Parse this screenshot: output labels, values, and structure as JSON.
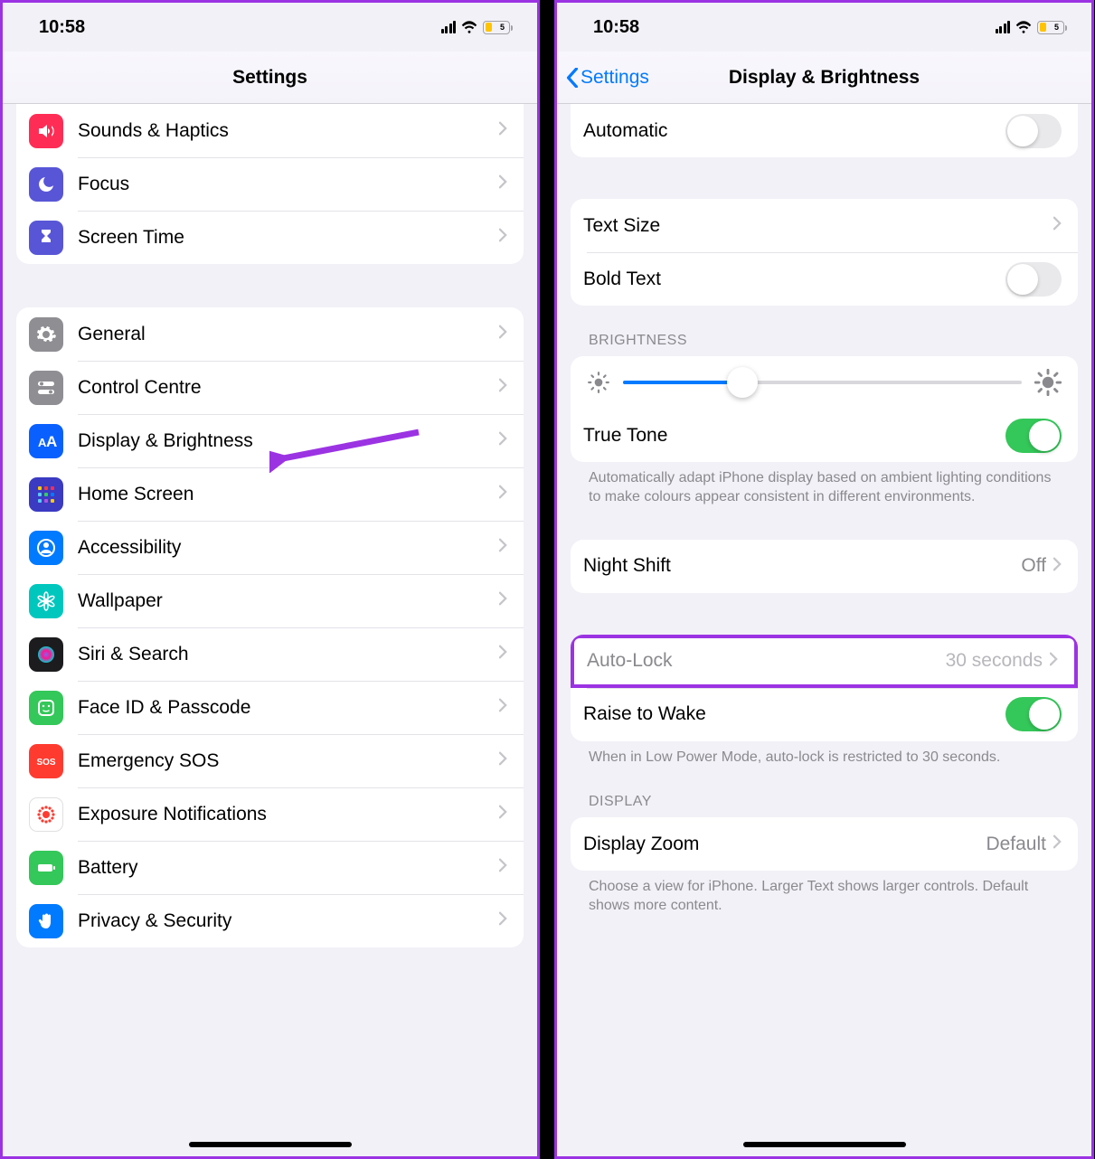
{
  "status": {
    "time": "10:58",
    "battery_pct": "5"
  },
  "left": {
    "title": "Settings",
    "group1": [
      {
        "label": "Sounds & Haptics",
        "icon": "speaker",
        "color": "#ff2d55"
      },
      {
        "label": "Focus",
        "icon": "moon",
        "color": "#5856d6"
      },
      {
        "label": "Screen Time",
        "icon": "hourglass",
        "color": "#5856d6"
      }
    ],
    "group2": [
      {
        "label": "General",
        "icon": "gear",
        "color": "#8e8e93"
      },
      {
        "label": "Control Centre",
        "icon": "switches",
        "color": "#8e8e93"
      },
      {
        "label": "Display & Brightness",
        "icon": "aa",
        "color": "#0a60ff"
      },
      {
        "label": "Home Screen",
        "icon": "grid",
        "color": "#3a3ac2"
      },
      {
        "label": "Accessibility",
        "icon": "person",
        "color": "#007aff"
      },
      {
        "label": "Wallpaper",
        "icon": "flower",
        "color": "#00c7be"
      },
      {
        "label": "Siri & Search",
        "icon": "siri",
        "color": "#1c1c1e"
      },
      {
        "label": "Face ID & Passcode",
        "icon": "face",
        "color": "#34c759"
      },
      {
        "label": "Emergency SOS",
        "icon": "sos",
        "color": "#ff3b30"
      },
      {
        "label": "Exposure Notifications",
        "icon": "exposure",
        "color": "#ffffff"
      },
      {
        "label": "Battery",
        "icon": "battery",
        "color": "#34c759"
      },
      {
        "label": "Privacy & Security",
        "icon": "hand",
        "color": "#007aff"
      }
    ]
  },
  "right": {
    "back": "Settings",
    "title": "Display & Brightness",
    "automatic_label": "Automatic",
    "automatic_on": false,
    "textsize_label": "Text Size",
    "bold_label": "Bold Text",
    "bold_on": false,
    "brightness_header": "BRIGHTNESS",
    "brightness_pct": 30,
    "truetone_label": "True Tone",
    "truetone_on": true,
    "truetone_footer": "Automatically adapt iPhone display based on ambient lighting conditions to make colours appear consistent in different environments.",
    "nightshift_label": "Night Shift",
    "nightshift_value": "Off",
    "autolock_label": "Auto-Lock",
    "autolock_value": "30 seconds",
    "raise_label": "Raise to Wake",
    "raise_on": true,
    "raise_footer": "When in Low Power Mode, auto-lock is restricted to 30 seconds.",
    "display_header": "DISPLAY",
    "zoom_label": "Display Zoom",
    "zoom_value": "Default",
    "zoom_footer": "Choose a view for iPhone. Larger Text shows larger controls. Default shows more content."
  }
}
